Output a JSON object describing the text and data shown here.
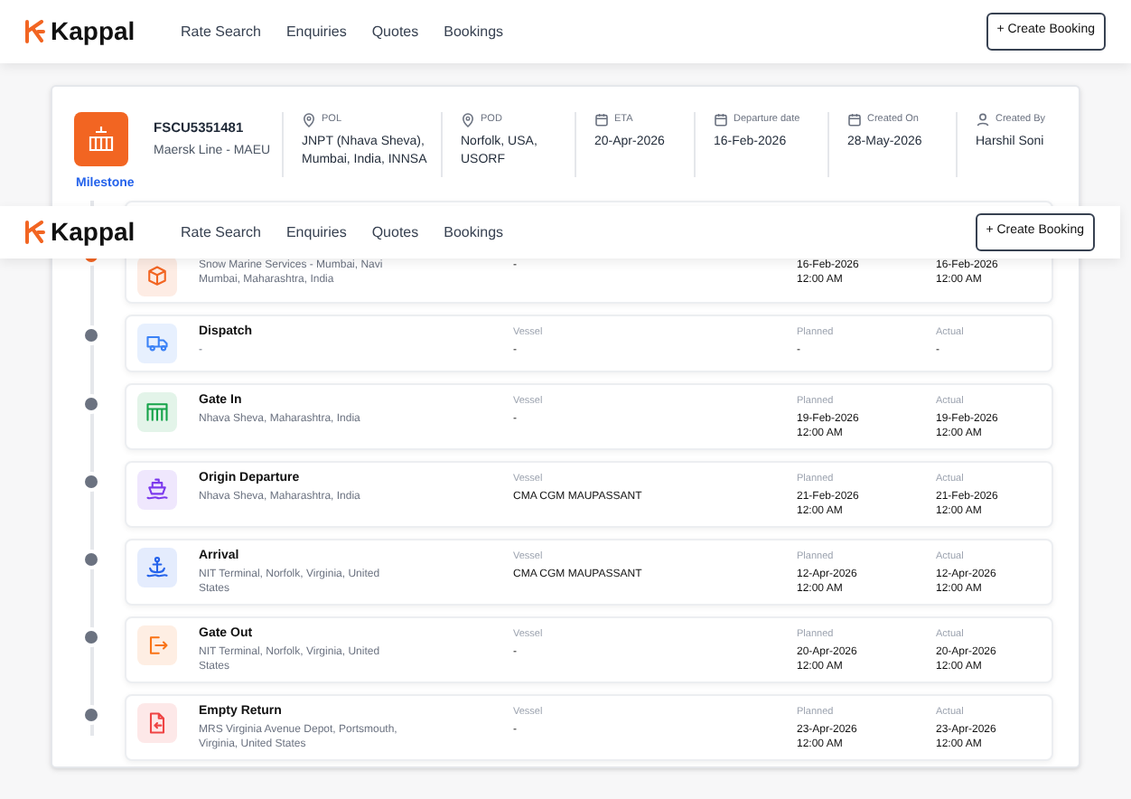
{
  "nav": {
    "brand": "Kappal",
    "links": [
      "Rate Search",
      "Enquiries",
      "Quotes",
      "Bookings"
    ],
    "button": "+ Create Booking"
  },
  "sticky_nav": {
    "brand": "Kappal",
    "links": [
      "Rate Search",
      "Enquiries",
      "Quotes",
      "Bookings"
    ],
    "button": "+ Create Booking"
  },
  "shipment": {
    "container": "FSCU5351481",
    "carrier": "Maersk Line - MAEU",
    "fields": [
      {
        "kind": "pin",
        "label": "POL",
        "value": "JNPT (Nhava Sheva), Mumbai, India, INNSA"
      },
      {
        "kind": "pin",
        "label": "POD",
        "value": "Norfolk, USA, USORF"
      },
      {
        "kind": "calendar",
        "label": "ETA",
        "value": "20-Apr-2026"
      },
      {
        "kind": "calendar",
        "label": "Departure date",
        "value": "16-Feb-2026"
      },
      {
        "kind": "calendar",
        "label": "Created On",
        "value": "28-May-2026"
      },
      {
        "kind": "person",
        "label": "Created By",
        "value": "Harshil Soni"
      }
    ]
  },
  "section_title": "Milestone",
  "milestones": [
    {
      "kind": "box",
      "active": true,
      "color": "#f26522",
      "location": "Snow Marine Services - Mumbai, Navi Mumbai, Maharashtra, India",
      "vessel": "-",
      "planned": "16-Feb-2026 12:00 AM",
      "actual": "16-Feb-2026 12:00 AM"
    },
    {
      "kind": "truck",
      "active": false,
      "color": "#3b82f6",
      "title": "Dispatch",
      "location": "-",
      "vessel_label": "Vessel",
      "vessel": "-",
      "planned_label": "Planned",
      "planned": "-",
      "actual_label": "Actual",
      "actual": "-"
    },
    {
      "kind": "gate",
      "active": false,
      "color": "#16a34a",
      "title": "Gate In",
      "location": "Nhava Sheva, Maharashtra, India",
      "vessel_label": "Vessel",
      "vessel": "-",
      "planned_label": "Planned",
      "planned": "19-Feb-2026 12:00 AM",
      "actual_label": "Actual",
      "actual": "19-Feb-2026 12:00 AM"
    },
    {
      "kind": "ship",
      "active": false,
      "color": "#7c3aed",
      "title": "Origin Departure",
      "location": "Nhava Sheva, Maharashtra, India",
      "vessel_label": "Vessel",
      "vessel": "CMA CGM MAUPASSANT",
      "planned_label": "Planned",
      "planned": "21-Feb-2026 12:00 AM",
      "actual_label": "Actual",
      "actual": "21-Feb-2026 12:00 AM"
    },
    {
      "kind": "anchor",
      "active": false,
      "color": "#2563eb",
      "title": "Arrival",
      "location": "NIT Terminal, Norfolk, Virginia, United States",
      "vessel_label": "Vessel",
      "vessel": "CMA CGM MAUPASSANT",
      "planned_label": "Planned",
      "planned": "12-Apr-2026 12:00 AM",
      "actual_label": "Actual",
      "actual": "12-Apr-2026 12:00 AM"
    },
    {
      "kind": "exit",
      "active": false,
      "color": "#f97316",
      "title": "Gate Out",
      "location": "NIT Terminal, Norfolk, Virginia, United States",
      "vessel_label": "Vessel",
      "vessel": "-",
      "planned_label": "Planned",
      "planned": "20-Apr-2026 12:00 AM",
      "actual_label": "Actual",
      "actual": "20-Apr-2026 12:00 AM"
    },
    {
      "kind": "return",
      "active": false,
      "color": "#ef4444",
      "title": "Empty Return",
      "location": "MRS Virginia Avenue Depot, Portsmouth, Virginia, United States",
      "vessel_label": "Vessel",
      "vessel": "-",
      "planned_label": "Planned",
      "planned": "23-Apr-2026 12:00 AM",
      "actual_label": "Actual",
      "actual": "23-Apr-2026 12:00 AM"
    }
  ]
}
